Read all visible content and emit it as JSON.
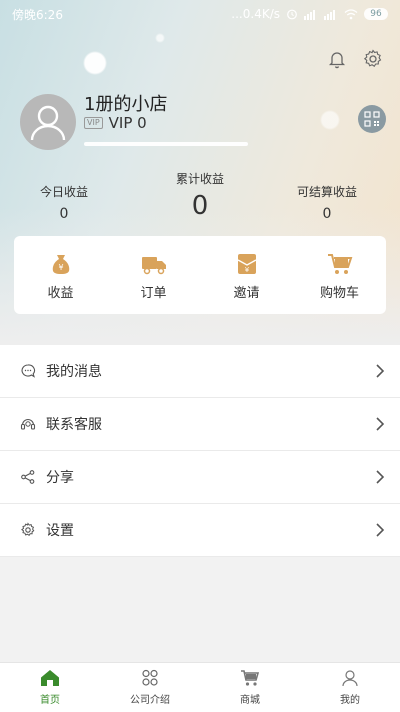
{
  "status_bar": {
    "time": "傍晚6:26",
    "network": "...0.4K/s",
    "battery": "96"
  },
  "profile": {
    "shop_name": "1册的小店",
    "vip_tag": "VIP",
    "vip_level": "VIP 0"
  },
  "stats": {
    "today_label": "今日收益",
    "today_value": "0",
    "total_label": "累计收益",
    "total_value": "0",
    "settle_label": "可结算收益",
    "settle_value": "0"
  },
  "quick_actions": [
    {
      "label": "收益",
      "icon": "money-bag-icon"
    },
    {
      "label": "订单",
      "icon": "truck-icon"
    },
    {
      "label": "邀请",
      "icon": "invite-envelope-icon"
    },
    {
      "label": "购物车",
      "icon": "cart-icon"
    }
  ],
  "menu": [
    {
      "label": "我的消息",
      "icon": "message-icon"
    },
    {
      "label": "联系客服",
      "icon": "headset-icon"
    },
    {
      "label": "分享",
      "icon": "share-icon"
    },
    {
      "label": "设置",
      "icon": "gear-icon"
    }
  ],
  "tabs": [
    {
      "label": "首页",
      "icon": "home-icon",
      "active": true
    },
    {
      "label": "公司介绍",
      "icon": "grid-icon",
      "active": false
    },
    {
      "label": "商城",
      "icon": "cart-icon",
      "active": false
    },
    {
      "label": "我的",
      "icon": "person-icon",
      "active": false
    }
  ],
  "colors": {
    "accent_green": "#3a8b2c",
    "icon_orange": "#d9a35b",
    "avatar_gray": "#b8b8b8"
  }
}
